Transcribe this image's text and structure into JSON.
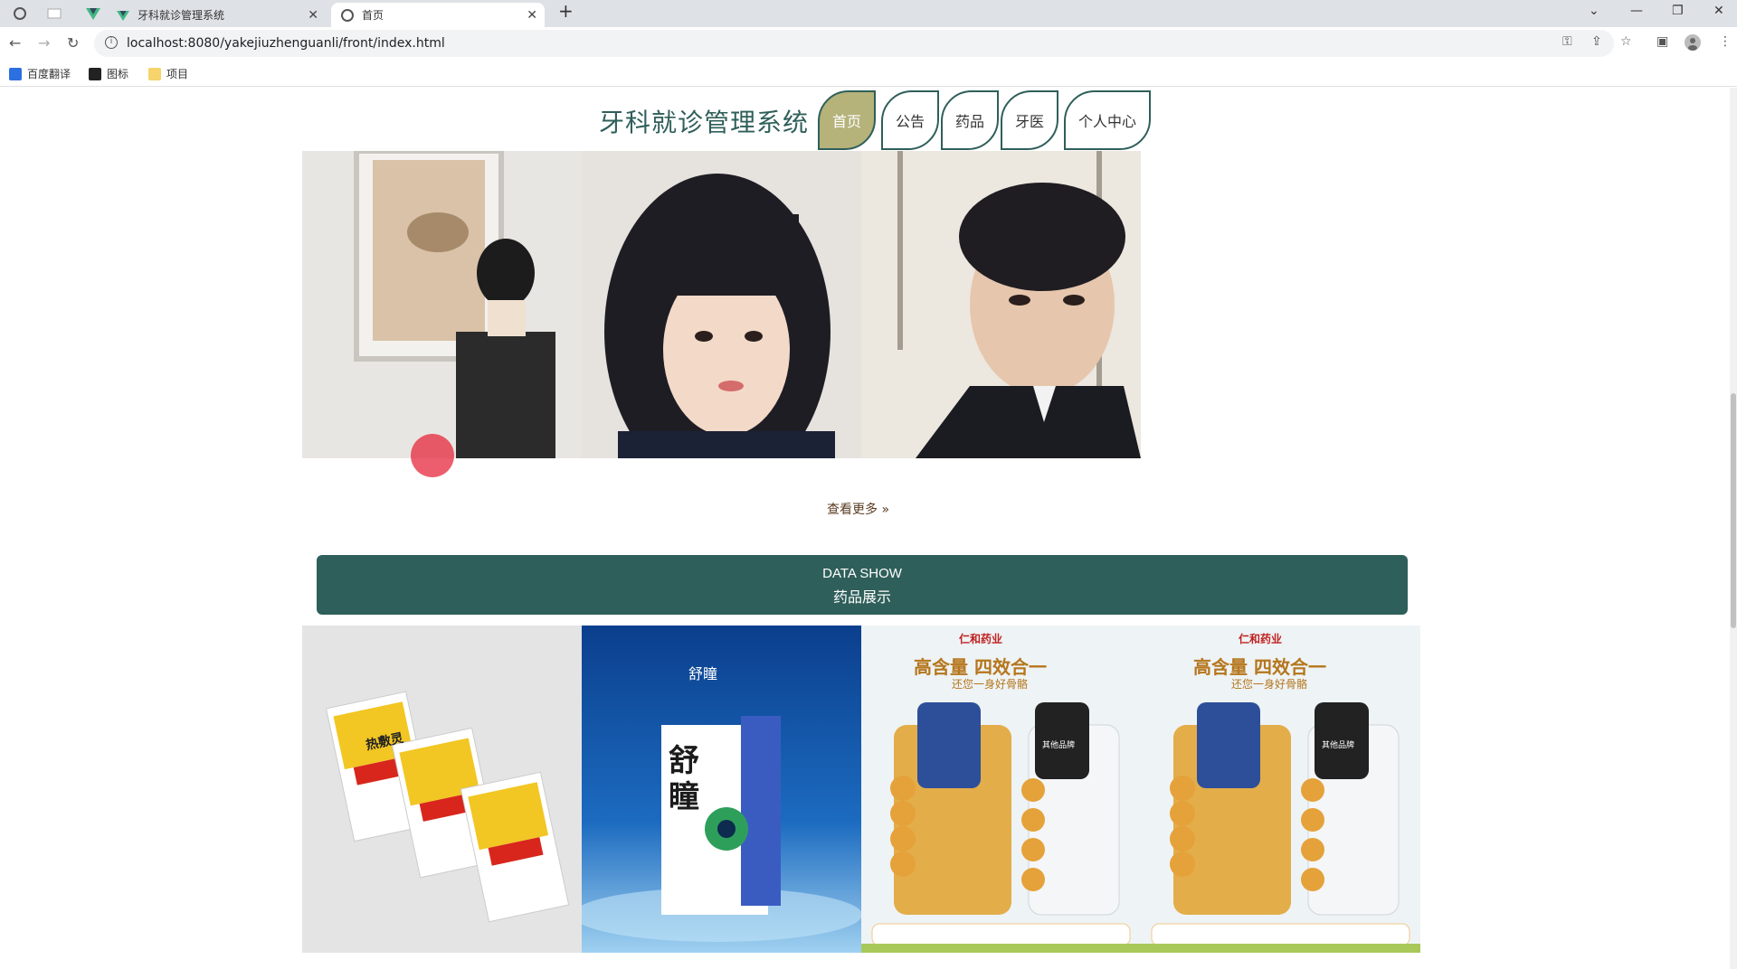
{
  "browser": {
    "tabs": [
      {
        "label": "牙科就诊管理系统"
      },
      {
        "label": "首页"
      }
    ],
    "url": "localhost:8080/yakejiuzhenguanli/front/index.html",
    "bookmarks": [
      "百度翻译",
      "图标",
      "项目"
    ]
  },
  "site": {
    "title": "牙科就诊管理系统",
    "nav": [
      "首页",
      "公告",
      "药品",
      "牙医",
      "个人中心"
    ],
    "more_label": "查看更多",
    "section": {
      "en": "DATA SHOW",
      "zh": "药品展示"
    }
  },
  "products": {
    "p1": {
      "name": "热敷灵"
    },
    "p2": {
      "brand": "舒瞳",
      "name": "舒瞳"
    },
    "p3": {
      "brand": "仁和药业",
      "headline": "高含量 四效合一",
      "sub": "还您一身好骨骼",
      "other": "其他品牌"
    },
    "p4": {
      "brand": "仁和药业",
      "headline": "高含量 四效合一",
      "sub": "还您一身好骨骼",
      "other": "其他品牌"
    }
  },
  "colors": {
    "accent": "#2f5f5a",
    "nav_active": "#b5b27a"
  }
}
